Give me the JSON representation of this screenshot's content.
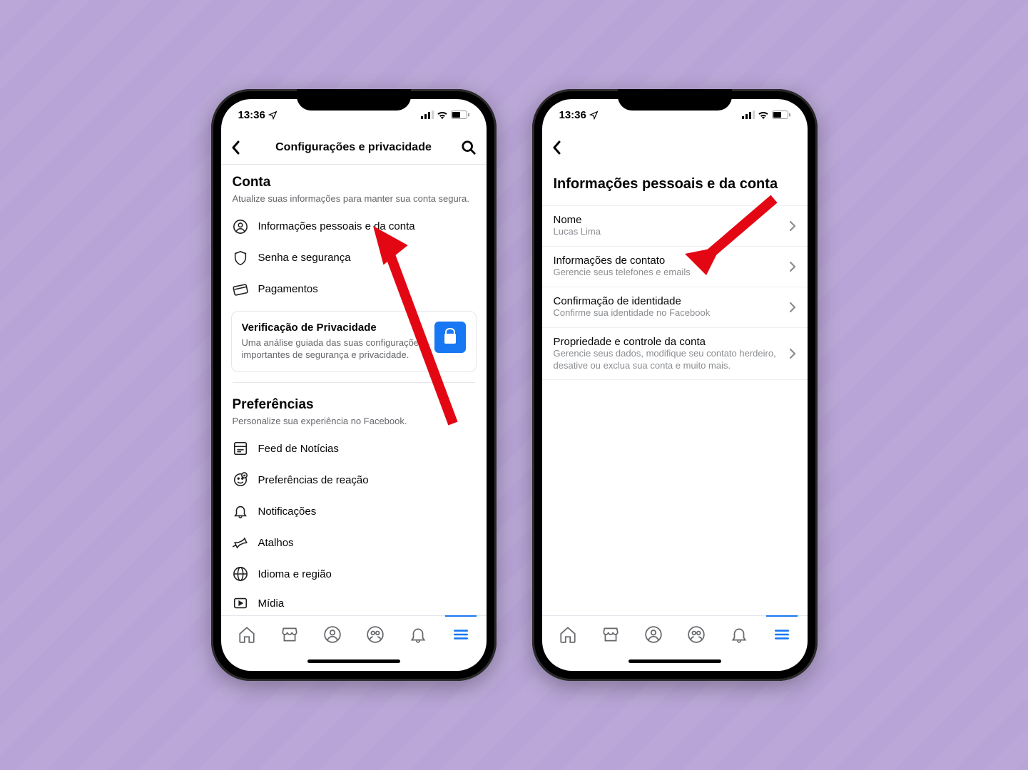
{
  "status_time": "13:36",
  "left_phone": {
    "nav_title": "Configurações e privacidade",
    "section1": {
      "title": "Conta",
      "sub": "Atualize suas informações para manter sua conta segura.",
      "items": [
        {
          "label": "Informações pessoais e da conta"
        },
        {
          "label": "Senha e segurança"
        },
        {
          "label": "Pagamentos"
        }
      ],
      "privacy_card": {
        "title": "Verificação de Privacidade",
        "sub": "Uma análise guiada das suas configurações importantes de segurança e privacidade."
      }
    },
    "section2": {
      "title": "Preferências",
      "sub": "Personalize sua experiência no Facebook.",
      "items": [
        {
          "label": "Feed de Notícias"
        },
        {
          "label": "Preferências de reação"
        },
        {
          "label": "Notificações"
        },
        {
          "label": "Atalhos"
        },
        {
          "label": "Idioma e região"
        },
        {
          "label": "Mídia"
        }
      ]
    }
  },
  "right_phone": {
    "page_title": "Informações pessoais e da conta",
    "rows": [
      {
        "label": "Nome",
        "sub": "Lucas Lima"
      },
      {
        "label": "Informações de contato",
        "sub": "Gerencie seus telefones e emails"
      },
      {
        "label": "Confirmação de identidade",
        "sub": "Confirme sua identidade no Facebook"
      },
      {
        "label": "Propriedade e controle da conta",
        "sub": "Gerencie seus dados, modifique seu contato herdeiro, desative ou exclua sua conta e muito mais."
      }
    ]
  }
}
